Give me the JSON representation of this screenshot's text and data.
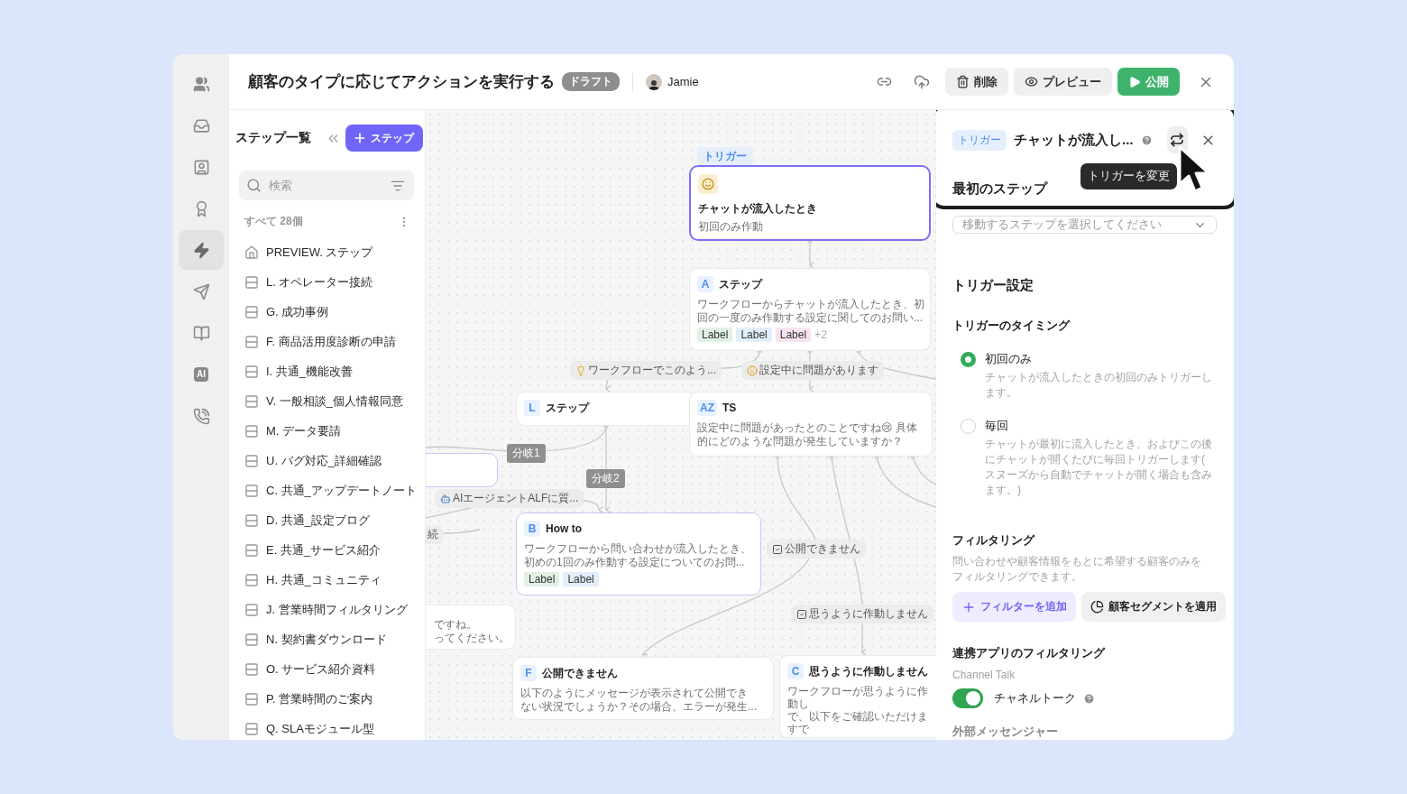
{
  "rail": [
    {
      "kind": "people",
      "selected": false
    },
    {
      "kind": "inbox",
      "selected": false
    },
    {
      "kind": "contacts",
      "selected": false
    },
    {
      "kind": "award",
      "selected": false
    },
    {
      "kind": "bolt",
      "selected": true
    },
    {
      "kind": "send",
      "selected": false
    },
    {
      "kind": "book",
      "selected": false
    },
    {
      "kind": "ai",
      "label": "AI",
      "selected": false
    },
    {
      "kind": "call",
      "selected": false
    }
  ],
  "header": {
    "title": "顧客のタイプに応じてアクションを実行する",
    "status": "ドラフト",
    "user": "Jamie",
    "tools": [
      {
        "kind": "link"
      },
      {
        "kind": "upload"
      }
    ],
    "actions": [
      {
        "kind": "delete",
        "label": "削除"
      },
      {
        "kind": "preview",
        "label": "プレビュー"
      },
      {
        "kind": "publish",
        "label": "公開"
      }
    ]
  },
  "steps_panel": {
    "title": "ステップ一覧",
    "add_label": "ステップ",
    "search": {
      "placeholder": "検索"
    },
    "count": "すべて 28個",
    "items": [
      {
        "kind": "home",
        "label": "PREVIEW. ステップ"
      },
      {
        "kind": "step",
        "label": "L. オペレーター接続"
      },
      {
        "kind": "step",
        "label": "G. 成功事例"
      },
      {
        "kind": "step",
        "label": "F. 商品活用度診断の申請"
      },
      {
        "kind": "step",
        "label": "I. 共通_機能改善"
      },
      {
        "kind": "step",
        "label": "V. 一般相談_個人情報同意"
      },
      {
        "kind": "step",
        "label": "M. データ要請"
      },
      {
        "kind": "step",
        "label": "U. バグ対応_詳細確認"
      },
      {
        "kind": "step",
        "label": "C. 共通_アップデートノート"
      },
      {
        "kind": "step",
        "label": "D. 共通_設定ブログ"
      },
      {
        "kind": "step",
        "label": "E. 共通_サービス紹介"
      },
      {
        "kind": "step",
        "label": "H. 共通_コミュニティ"
      },
      {
        "kind": "step",
        "label": "J. 営業時間フィルタリング"
      },
      {
        "kind": "step",
        "label": "N. 契約書ダウンロード"
      },
      {
        "kind": "step",
        "label": "O. サービス紹介資料"
      },
      {
        "kind": "step",
        "label": "P. 営業時間のご案内"
      },
      {
        "kind": "step",
        "label": "Q. SLAモジュール型"
      }
    ]
  },
  "canvas": {
    "nodes": [
      {
        "kind": "trigger",
        "tag": "トリガー",
        "title": "チャットが流入したとき",
        "description": [
          "初回のみ作動"
        ],
        "selected": true,
        "outlined": true
      },
      {
        "kind": "step",
        "badge": "A",
        "title": "ステップ",
        "description": [
          "ワークフローからチャットが流入したとき、初",
          "回の一度のみ作動する設定に関してのお問い..."
        ],
        "labels": [
          {
            "text": "Label",
            "color": "#e2f1e5"
          },
          {
            "text": "Label",
            "color": "#e2eefb"
          },
          {
            "text": "Label",
            "color": "#f8e4f0"
          }
        ],
        "more": "+2",
        "selected": false,
        "outlined": false
      },
      {
        "kind": "step",
        "badge": "L",
        "title": "ステップ",
        "selected": false,
        "outlined": false
      },
      {
        "kind": "step",
        "badge": "AZ",
        "title": "TS",
        "description": [
          "設定中に問題があったとのことですね😢 具体",
          "的にどのような問題が発生していますか？"
        ],
        "selected": false,
        "outlined": false
      },
      {
        "kind": "step",
        "selected": false,
        "outlined": true
      },
      {
        "kind": "step",
        "badge": "B",
        "title": "How to",
        "description": [
          "ワークフローから問い合わせが流入したとき、",
          "初めの1回のみ作動する設定についてのお問..."
        ],
        "labels": [
          {
            "text": "Label",
            "color": "#e2f1e5"
          },
          {
            "text": "Label",
            "color": "#e2eefb"
          }
        ],
        "selected": false,
        "outlined": true
      },
      {
        "kind": "step",
        "description": [
          "ですね。",
          "ってください。"
        ],
        "selected": false,
        "outlined": false
      },
      {
        "kind": "step",
        "badge": "F",
        "title": "公開できません",
        "description": [
          "以下のようにメッセージが表示されて公開でき",
          "ない状況でしょうか？その場合、エラーが発生..."
        ],
        "selected": false,
        "outlined": false
      },
      {
        "kind": "step",
        "badge": "C",
        "title": "思うように作動しません",
        "description": [
          "ワークフローが思うように作動し",
          "で、以下をご確認いただけますで"
        ],
        "selected": false,
        "outlined": false
      }
    ],
    "edge_labels": [
      {
        "kind": "idea",
        "text": "ワークフローでこのよう..."
      },
      {
        "kind": "problem",
        "text": "設定中に問題があります"
      },
      {
        "kind": "branch",
        "text": "分岐1"
      },
      {
        "kind": "branch",
        "text": "分岐2"
      },
      {
        "kind": "ai",
        "text": "AIエージェントALFに質..."
      },
      {
        "kind": "plain",
        "text": "続"
      },
      {
        "kind": "checked",
        "text": "公開できません"
      },
      {
        "kind": "checked",
        "text": "思うように作動しません"
      }
    ]
  },
  "trigger_panel": {
    "tag": "トリガー",
    "title": "チャットが流入し...",
    "swap_tooltip": "トリガーを変更",
    "first_step": {
      "label": "最初のステップ",
      "placeholder": "移動するステップを選択してください"
    },
    "settings_title": "トリガー設定",
    "timing": {
      "title": "トリガーのタイミング",
      "options": [
        {
          "label": "初回のみ",
          "description": "チャットが流入したときの初回のみトリガーします。",
          "selected": true
        },
        {
          "label": "毎回",
          "description": "チャットが最初に流入したとき、およびこの後にチャットが開くたびに毎回トリガーします(スヌーズから自動でチャットが開く場合も含みます。)",
          "selected": false
        }
      ]
    },
    "filtering": {
      "title": "フィルタリング",
      "description": "問い合わせや顧客情報をもとに希望する顧客のみをフィルタリングできます。",
      "buttons": [
        {
          "kind": "add",
          "label": "フィルターを追加"
        },
        {
          "kind": "segment",
          "label": "顧客セグメントを適用"
        }
      ]
    },
    "app_filtering": {
      "title": "連携アプリのフィルタリング",
      "app": "Channel Talk",
      "toggle": {
        "label": "チャネルトーク",
        "on": true
      },
      "next_title": "外部メッセンジャー"
    }
  }
}
